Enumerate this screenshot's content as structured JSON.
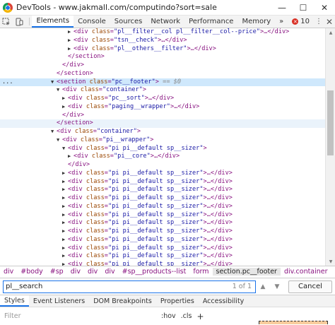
{
  "window": {
    "title": "DevTools - www.jakmall.com/computindo?sort=sale",
    "minimize": "—",
    "maximize": "☐",
    "close": "✕"
  },
  "toolbar": {
    "tabs": [
      "Elements",
      "Console",
      "Sources",
      "Network",
      "Performance",
      "Memory"
    ],
    "active_tab": "Elements",
    "more": "»",
    "error_count": "10",
    "kebab": "⋮",
    "close": "✕"
  },
  "tree": {
    "gutter_dots": "...",
    "selected_suffix": "== $0",
    "lines": [
      {
        "indent": 4,
        "tri": "▶",
        "tag": "div",
        "cls": "pl__filter__col pl__filter__col--price",
        "end": "…</div>"
      },
      {
        "indent": 4,
        "tri": "▶",
        "tag": "div",
        "cls": "tsn__check",
        "end": "…</div>"
      },
      {
        "indent": 4,
        "tri": "▶",
        "tag": "div",
        "cls": "pl__others__filter",
        "end": "…</div>"
      },
      {
        "indent": 3,
        "tri": "",
        "close": "</section>"
      },
      {
        "indent": 2,
        "tri": "",
        "close": "</div>"
      },
      {
        "indent": 1,
        "tri": "",
        "close": "</section>"
      },
      {
        "indent": 1,
        "tri": "▼",
        "tag": "section",
        "cls": "pc__footer",
        "end": "",
        "selected": true
      },
      {
        "indent": 2,
        "tri": "▼",
        "tag": "div",
        "cls": "container",
        "end": ""
      },
      {
        "indent": 3,
        "tri": "▶",
        "tag": "div",
        "cls": "pc__sort",
        "end": "…</div>"
      },
      {
        "indent": 3,
        "tri": "▶",
        "tag": "div",
        "cls": "paging__wrapper",
        "end": "…</div>"
      },
      {
        "indent": 2,
        "tri": "",
        "close": "</div>"
      },
      {
        "indent": 1,
        "tri": "",
        "close": "</section>",
        "hl": true
      },
      {
        "indent": 1,
        "tri": "▼",
        "tag": "div",
        "cls": "container",
        "end": ""
      },
      {
        "indent": 2,
        "tri": "▼",
        "tag": "div",
        "cls": "pi__wrapper",
        "end": ""
      },
      {
        "indent": 3,
        "tri": "▼",
        "tag": "div",
        "cls": "pi pi__default sp__sizer",
        "end": ""
      },
      {
        "indent": 4,
        "tri": "▶",
        "tag": "div",
        "cls": "pi__core",
        "end": "…</div>"
      },
      {
        "indent": 3,
        "tri": "",
        "close": "</div>"
      },
      {
        "indent": 3,
        "tri": "▶",
        "tag": "div",
        "cls": "pi pi__default sp__sizer",
        "end": "…</div>"
      },
      {
        "indent": 3,
        "tri": "▶",
        "tag": "div",
        "cls": "pi pi__default sp__sizer",
        "end": "…</div>"
      },
      {
        "indent": 3,
        "tri": "▶",
        "tag": "div",
        "cls": "pi pi__default sp__sizer",
        "end": "…</div>"
      },
      {
        "indent": 3,
        "tri": "▶",
        "tag": "div",
        "cls": "pi pi__default sp__sizer",
        "end": "…</div>"
      },
      {
        "indent": 3,
        "tri": "▶",
        "tag": "div",
        "cls": "pi pi__default sp__sizer",
        "end": "…</div>"
      },
      {
        "indent": 3,
        "tri": "▶",
        "tag": "div",
        "cls": "pi pi__default sp__sizer",
        "end": "…</div>"
      },
      {
        "indent": 3,
        "tri": "▶",
        "tag": "div",
        "cls": "pi pi__default sp__sizer",
        "end": "…</div>"
      },
      {
        "indent": 3,
        "tri": "▶",
        "tag": "div",
        "cls": "pi pi__default sp__sizer",
        "end": "…</div>"
      },
      {
        "indent": 3,
        "tri": "▶",
        "tag": "div",
        "cls": "pi pi__default sp__sizer",
        "end": "…</div>"
      },
      {
        "indent": 3,
        "tri": "▶",
        "tag": "div",
        "cls": "pi pi__default sp__sizer",
        "end": "…</div>"
      },
      {
        "indent": 3,
        "tri": "▶",
        "tag": "div",
        "cls": "pi pi__default sp__sizer",
        "end": "…</div>"
      },
      {
        "indent": 3,
        "tri": "▶",
        "tag": "div",
        "cls": "pi pi__default sp__sizer",
        "end": "…</div>"
      }
    ]
  },
  "breadcrumb": [
    "div",
    "#body",
    "#sp",
    "div",
    "div",
    "div",
    "#sp__products--list",
    "form",
    "section.pc__footer",
    "div.container"
  ],
  "breadcrumb_current": "section.pc__footer",
  "search": {
    "value": "pl__search",
    "count": "1 of 1",
    "up": "▲",
    "down": "▼",
    "cancel": "Cancel"
  },
  "subtabs": [
    "Styles",
    "Event Listeners",
    "DOM Breakpoints",
    "Properties",
    "Accessibility"
  ],
  "subtab_active": "Styles",
  "filter": {
    "placeholder": "Filter",
    "hov": ":hov",
    "cls": ".cls",
    "plus": "+"
  },
  "colors": {
    "accent": "#1a73e8",
    "selected_row": "#cfe8fc",
    "tag": "#881280",
    "attr": "#994500",
    "value": "#1a1aa6",
    "error": "#d93025"
  }
}
